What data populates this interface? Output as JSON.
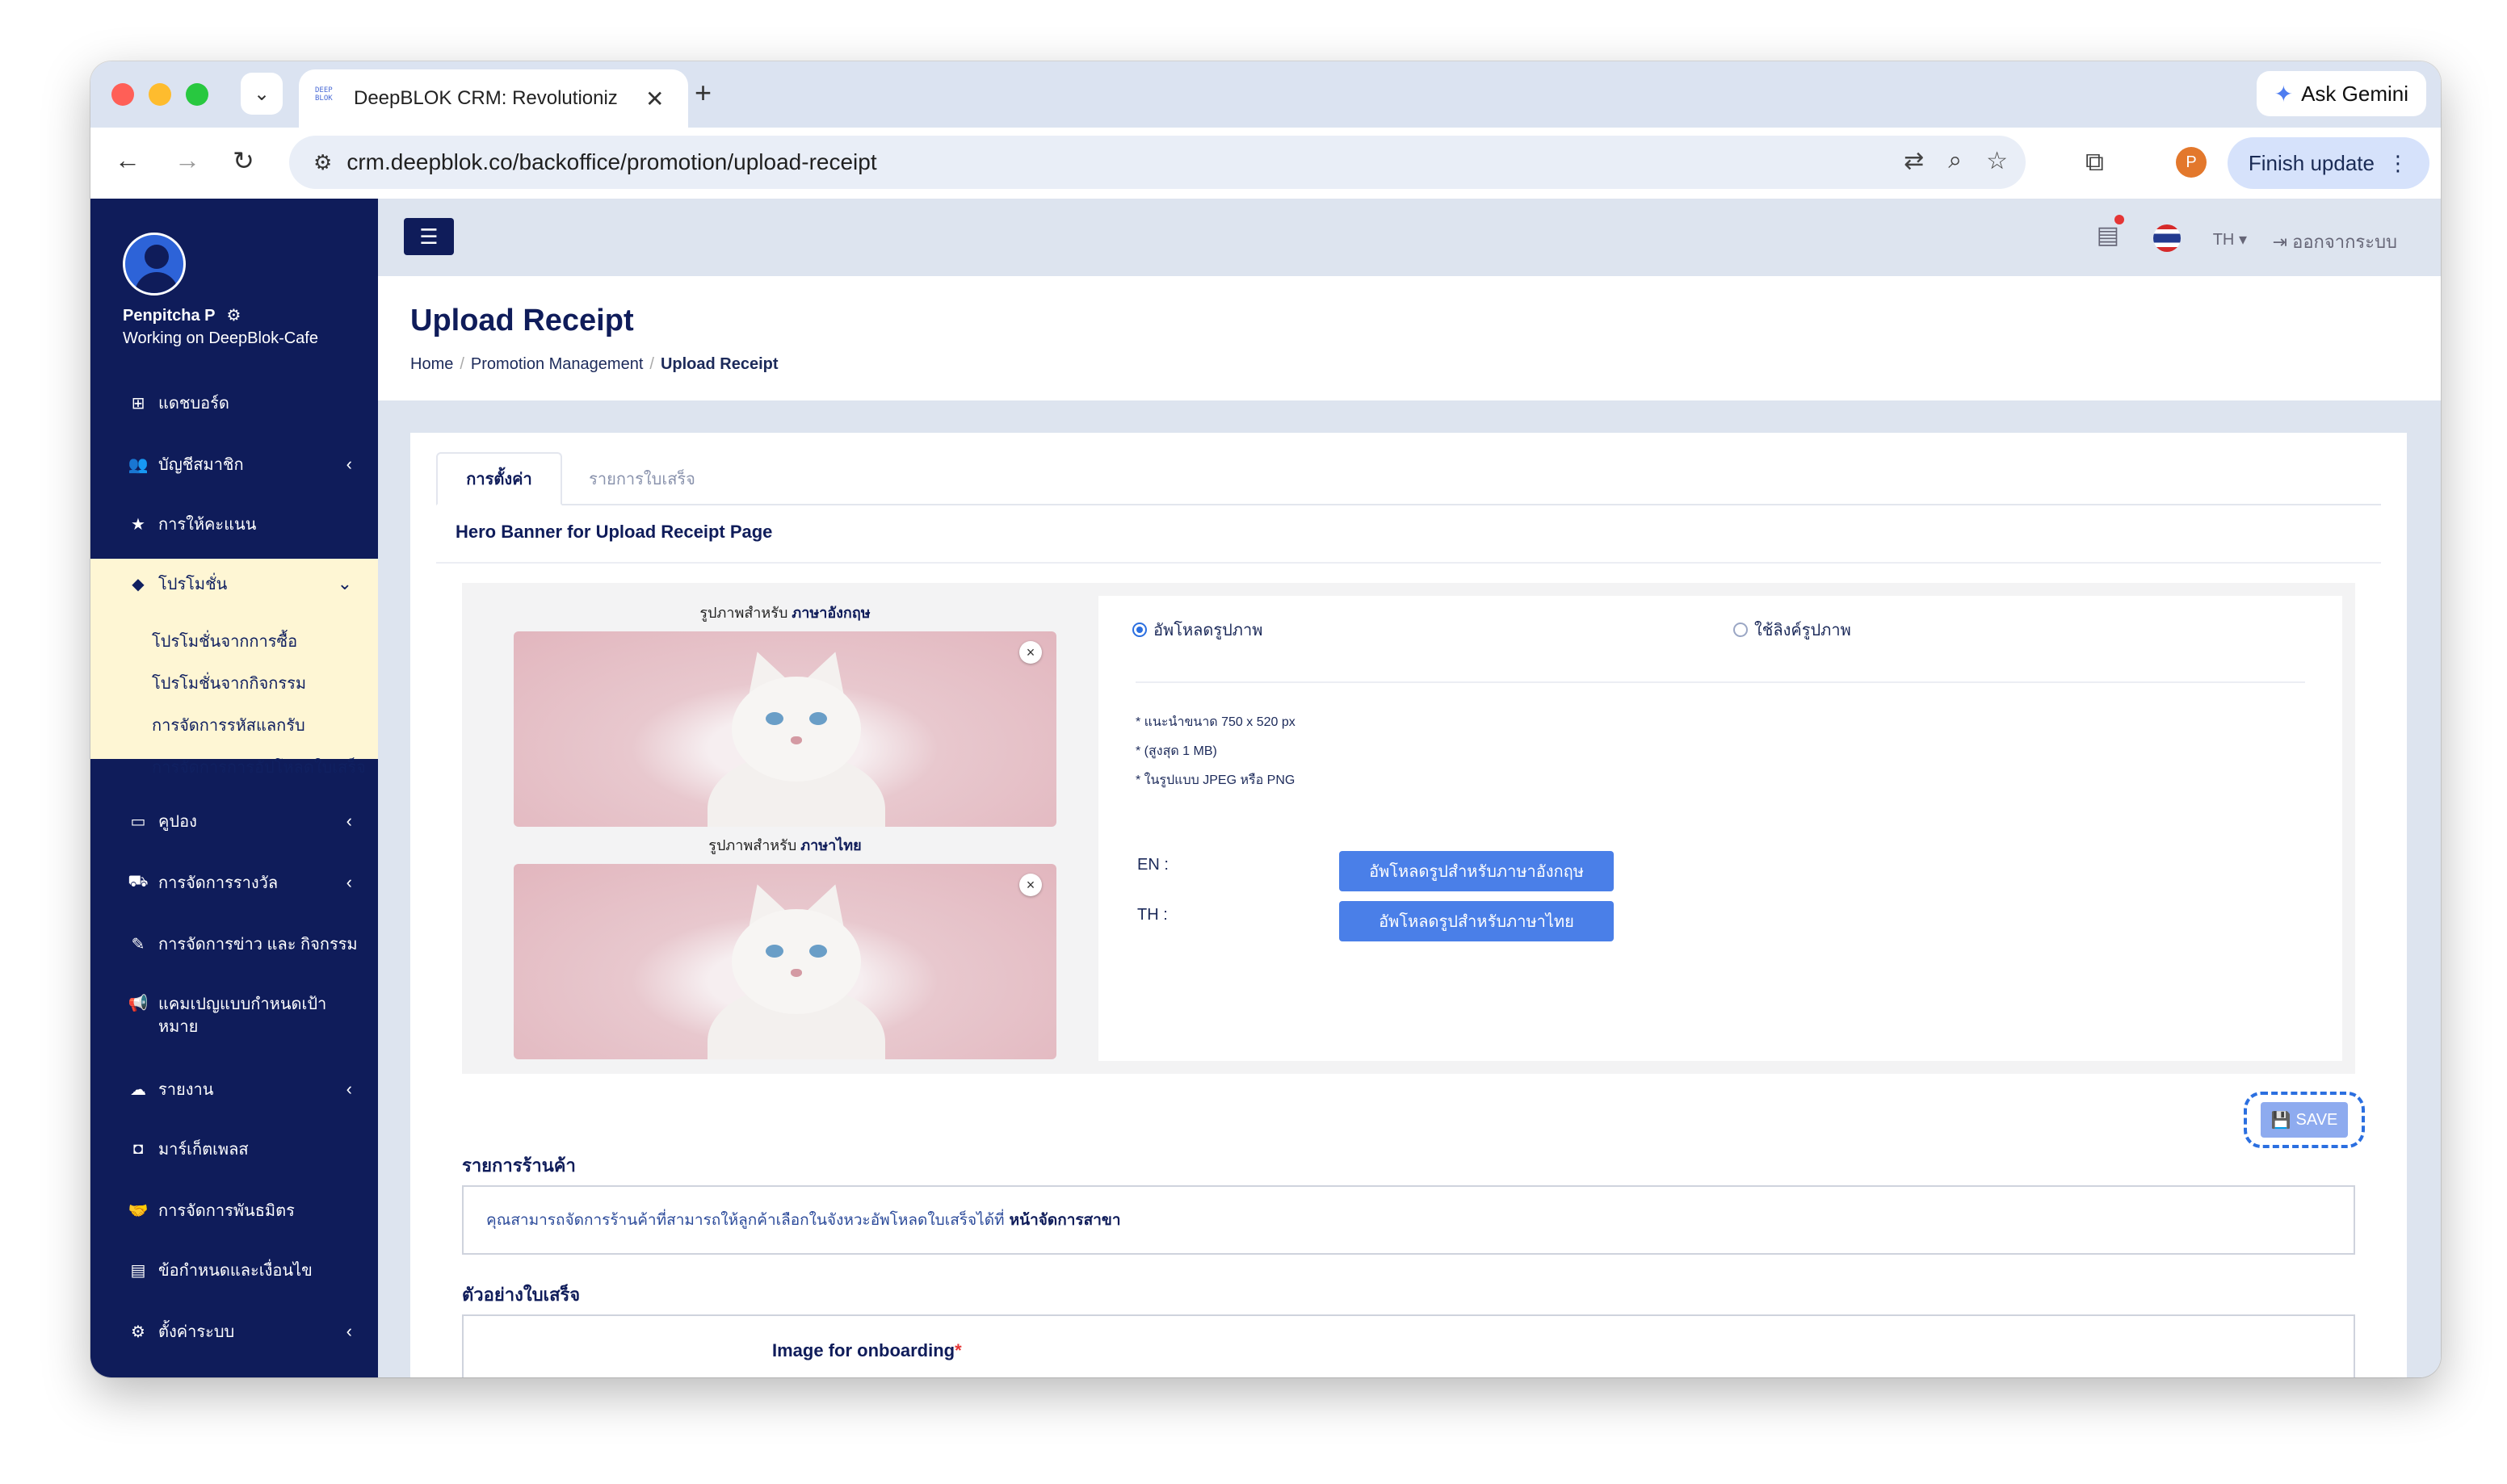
{
  "browser": {
    "tab_title": "DeepBLOK CRM: Revolutioniz",
    "tab_favicon": "DEEP BLOK",
    "url": "crm.deepblok.co/backoffice/promotion/upload-receipt",
    "gemini_label": "Ask Gemini",
    "profile_initial": "P",
    "finish_update_label": "Finish update"
  },
  "sidebar": {
    "user_name": "Penpitcha P",
    "user_working": "Working on DeepBlok-Cafe",
    "items": [
      {
        "label": "แดชบอร์ด",
        "icon": "dashboard-icon"
      },
      {
        "label": "บัญชีสมาชิก",
        "icon": "users-icon"
      },
      {
        "label": "การให้คะแนน",
        "icon": "star-icon"
      },
      {
        "label": "โปรโมชั่น",
        "icon": "tag-icon"
      },
      {
        "label": "คูปอง",
        "icon": "ticket-icon"
      },
      {
        "label": "การจัดการรางวัล",
        "icon": "cart-icon"
      },
      {
        "label": "การจัดการข่าว และ กิจกรรม",
        "icon": "edit-icon"
      },
      {
        "label": "แคมเปญแบบกำหนดเป้าหมาย",
        "icon": "megaphone-icon"
      },
      {
        "label": "รายงาน",
        "icon": "cloud-download-icon"
      },
      {
        "label": "มาร์เก็ตเพลส",
        "icon": "shopping-bag-icon"
      },
      {
        "label": "การจัดการพันธมิตร",
        "icon": "handshake-icon"
      },
      {
        "label": "ข้อกำหนดและเงื่อนไข",
        "icon": "file-icon"
      },
      {
        "label": "ตั้งค่าระบบ",
        "icon": "gear-icon"
      }
    ],
    "submenu": [
      "โปรโมชั่นจากการซื้อ",
      "โปรโมชั่นจากกิจกรรม",
      "การจัดการรหัสแลกรับ",
      "การจัดการการอัปโหลดใบเสร็จ"
    ]
  },
  "topbar": {
    "lang": "TH",
    "logout": "ออกจากระบบ"
  },
  "page": {
    "title": "Upload Receipt",
    "breadcrumb": [
      "Home",
      "Promotion Management",
      "Upload Receipt"
    ]
  },
  "tabs": [
    "การตั้งค่า",
    "รายการใบเสร็จ"
  ],
  "hero": {
    "section_title": "Hero Banner for Upload Receipt Page",
    "image_en_label_prefix": "รูปภาพสำหรับ",
    "image_en_label_lang": "ภาษาอังกฤษ",
    "image_th_label_prefix": "รูปภาพสำหรับ",
    "image_th_label_lang": "ภาษาไทย",
    "radio_upload": "อัพโหลดรูปภาพ",
    "radio_link": "ใช้ลิงค์รูปภาพ",
    "hints": [
      "* แนะนำขนาด 750 x 520 px",
      "* (สูงสุด 1 MB)",
      "* ในรูปแบบ JPEG หรือ PNG"
    ],
    "en_label": "EN :",
    "th_label": "TH :",
    "upload_en_button": "อัพโหลดรูปสำหรับภาษาอังกฤษ",
    "upload_th_button": "อัพโหลดรูปสำหรับภาษาไทย",
    "save_button": "SAVE"
  },
  "stores": {
    "title": "รายการร้านค้า",
    "info_text": "คุณสามารถจัดการร้านค้าที่สามารถให้ลูกค้าเลือกในจังหวะอัพโหลดใบเสร็จได้ที่",
    "info_link": "หน้าจัดการสาขา"
  },
  "example": {
    "title": "ตัวอย่างใบเสร็จ",
    "onboarding_label": "Image for onboarding",
    "required_mark": "*"
  }
}
